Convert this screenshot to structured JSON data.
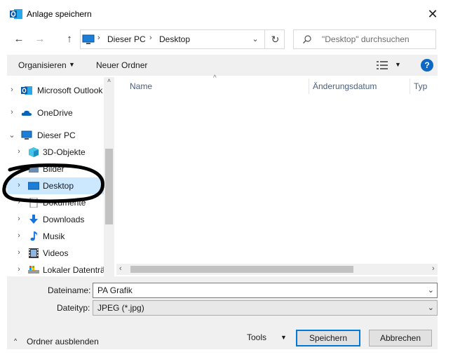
{
  "window": {
    "title": "Anlage speichern",
    "close_glyph": "✕"
  },
  "nav": {
    "back_glyph": "←",
    "forward_glyph": "→",
    "up_glyph": "↑",
    "address": {
      "crumbs": [
        "Dieser PC",
        "Desktop"
      ],
      "separator": "›",
      "dropdown_glyph": "⌄",
      "refresh_glyph": "↻"
    },
    "search": {
      "placeholder": "\"Desktop\" durchsuchen"
    }
  },
  "commandbar": {
    "organize_label": "Organisieren",
    "caret": "▼",
    "new_folder_label": "Neuer Ordner",
    "help_glyph": "?"
  },
  "tree": [
    {
      "label": "Microsoft Outlook",
      "chevron": "›",
      "icon": "outlook-icon",
      "level": 0
    },
    {
      "label": "OneDrive",
      "chevron": "›",
      "icon": "onedrive-cloud-icon",
      "level": 0
    },
    {
      "label": "Dieser PC",
      "chevron": "⌄",
      "icon": "computer-icon",
      "level": 0
    },
    {
      "label": "3D-Objekte",
      "chevron": "›",
      "icon": "cube-3d-icon",
      "level": 1
    },
    {
      "label": "Bilder",
      "chevron": "›",
      "icon": "pictures-icon",
      "level": 1
    },
    {
      "label": "Desktop",
      "chevron": "›",
      "icon": "desktop-icon",
      "level": 1,
      "selected": true
    },
    {
      "label": "Dokumente",
      "chevron": "›",
      "icon": "documents-icon",
      "level": 1
    },
    {
      "label": "Downloads",
      "chevron": "›",
      "icon": "download-arrow-icon",
      "level": 1
    },
    {
      "label": "Musik",
      "chevron": "›",
      "icon": "music-note-icon",
      "level": 1
    },
    {
      "label": "Videos",
      "chevron": "›",
      "icon": "video-film-icon",
      "level": 1
    },
    {
      "label": "Lokaler Datenträger",
      "chevron": "›",
      "icon": "local-disk-icon",
      "level": 1
    }
  ],
  "content": {
    "columns": [
      "Name",
      "Änderungsdatum",
      "Typ"
    ],
    "sort_caret": "^"
  },
  "scroll": {
    "up": "˄",
    "left": "‹",
    "right": "›"
  },
  "form": {
    "filename_label": "Dateiname:",
    "filename_value": "PA Grafik",
    "filetype_label": "Dateityp:",
    "filetype_value": "JPEG (*.jpg)",
    "dropdown_glyph": "⌄"
  },
  "footer": {
    "hide_folders_label": "Ordner ausblenden",
    "hide_caret": "^",
    "tools_label": "Tools",
    "tools_caret": "▼",
    "save_label": "Speichern",
    "cancel_label": "Abbrechen"
  },
  "colors": {
    "accent": "#0078d7",
    "selection": "#cce8ff",
    "annotation": "#000000"
  }
}
